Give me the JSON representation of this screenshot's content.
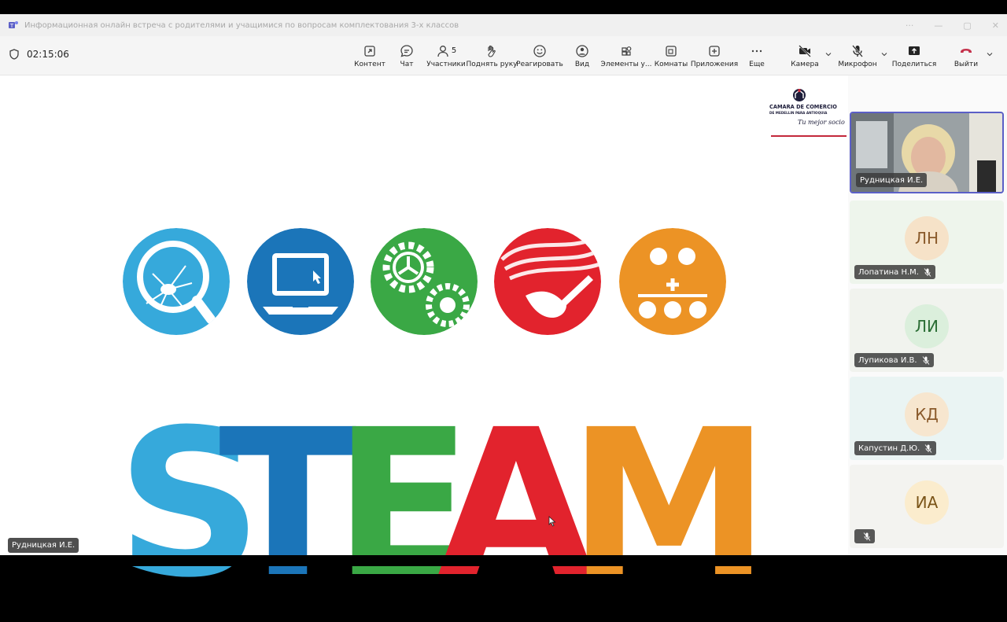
{
  "window": {
    "title": "Информационная онлайн встреча с родителями и учащимися по вопросам комплектования 3-х классов"
  },
  "toolbar": {
    "timer": "02:15:06",
    "buttons": {
      "content": "Контент",
      "chat": "Чат",
      "participants": "Участники",
      "participants_count": "5",
      "raise_hand": "Поднять руку",
      "react": "Реагировать",
      "view": "Вид",
      "apps_elements": "Элементы у...",
      "rooms": "Комнаты",
      "apps": "Приложения",
      "more": "Еще",
      "camera": "Камера",
      "mic": "Микрофон",
      "share": "Поделиться",
      "leave": "Выйти"
    }
  },
  "stage": {
    "logo_line1": "CAMARA DE COMERCIO",
    "logo_line2": "DE MEDELLIN PARA ANTIOQUIA",
    "logo_tagline": "Tu mejor socio",
    "steam_letters": [
      "S",
      "T",
      "E",
      "A",
      "M"
    ],
    "presenter": "Рудницкая И.Е."
  },
  "participants": [
    {
      "name": "Рудницкая И.Е.",
      "initials": "",
      "video": true
    },
    {
      "name": "Лопатина Н.М.",
      "initials": "ЛН"
    },
    {
      "name": "Лупикова И.В.",
      "initials": "ЛИ"
    },
    {
      "name": "Капустин Д.Ю.",
      "initials": "КД"
    },
    {
      "name": "",
      "initials": "ИА"
    }
  ],
  "colors": {
    "sky": "#36a9db",
    "blue": "#1b75b9",
    "green": "#3aa845",
    "red": "#e2232d",
    "orange": "#ec9325",
    "accent": "#5b5fc7",
    "leave": "#c4314b"
  }
}
